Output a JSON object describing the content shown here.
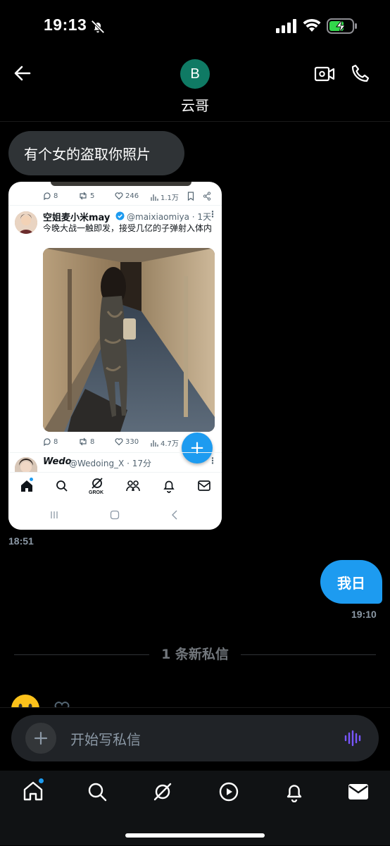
{
  "status_bar": {
    "time": "19:13"
  },
  "header": {
    "avatar_letter": "B",
    "contact_name": "云哥"
  },
  "messages": {
    "incoming_text": "有个女的盗取你照片",
    "incoming_time": "18:51",
    "outgoing_text": "我日",
    "outgoing_time": "19:10",
    "separator": "1 条新私信"
  },
  "screenshot": {
    "prev_stats": {
      "replies": "8",
      "reposts": "5",
      "likes": "246",
      "views": "1.1万"
    },
    "tweet": {
      "name": "空姐麦小米may",
      "handle": "@maixiaomiya · 1天",
      "text": "今晚大战一触即发，接受几亿的子弹射入体内",
      "stats": {
        "replies": "8",
        "reposts": "8",
        "likes": "330",
        "views": "4.7万"
      }
    },
    "next_tweet": {
      "name": "Wedo",
      "handle": "@Wedoing_X · 17分"
    },
    "nav": {
      "grok_label": "GROK"
    }
  },
  "composer": {
    "placeholder": "开始写私信"
  },
  "colors": {
    "accent": "#1d9bf0",
    "bubble_in": "#2f3336",
    "background": "#000000",
    "verified": "#1d9bf0"
  },
  "icons": [
    "bell-off-icon",
    "signal-icon",
    "wifi-icon",
    "battery-charging-icon",
    "back-arrow-icon",
    "video-call-icon",
    "phone-icon",
    "plus-icon",
    "voice-wave-icon",
    "home-icon",
    "search-icon",
    "grok-icon",
    "play-icon",
    "notifications-icon",
    "mail-icon"
  ]
}
